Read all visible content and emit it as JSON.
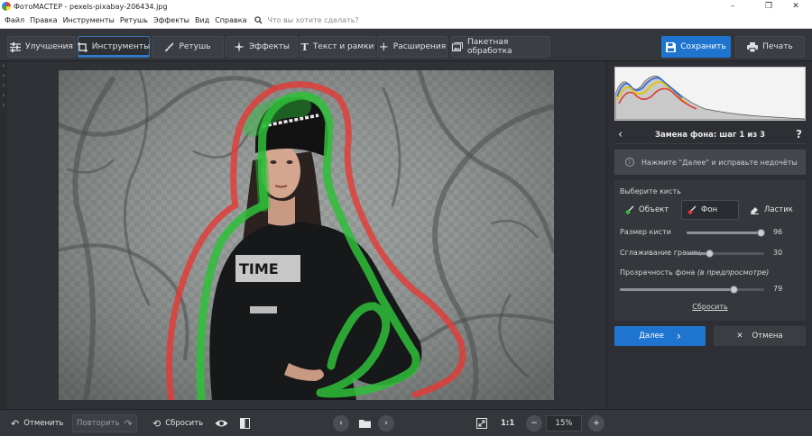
{
  "window": {
    "title": "ФотоМАСТЕР - pexels-pixabay-206434.jpg",
    "minimize_icon": "minimize-icon",
    "maximize_icon": "restore-icon",
    "close_icon": "close-icon"
  },
  "menu": {
    "items": [
      "Файл",
      "Правка",
      "Инструменты",
      "Ретушь",
      "Эффекты",
      "Вид",
      "Справка"
    ],
    "search_placeholder": "Что вы хотите сделать?"
  },
  "toolbar": {
    "tabs": [
      {
        "label": "Улучшения",
        "icon": "sliders-icon"
      },
      {
        "label": "Инструменты",
        "icon": "crop-icon",
        "active": true
      },
      {
        "label": "Ретушь",
        "icon": "brush-icon"
      },
      {
        "label": "Эффекты",
        "icon": "sparkle-icon"
      },
      {
        "label": "Текст и рамки",
        "icon": "text-icon"
      },
      {
        "label": "Расширения",
        "icon": "plus-icon"
      }
    ],
    "batch_label": "Пакетная обработка",
    "save_label": "Сохранить",
    "print_label": "Печать"
  },
  "panel": {
    "step_title": "Замена фона: шаг 1 из 3",
    "hint": "Нажмите \"Далее\" и исправьте недочёты",
    "brush_section_label": "Выберите кисть",
    "brushes": [
      {
        "label": "Объект",
        "color": "#2fbf3a"
      },
      {
        "label": "Фон",
        "color": "#e53935",
        "selected": true
      },
      {
        "label": "Ластик",
        "color": "#e0e0e0"
      }
    ],
    "brush_size": {
      "label": "Размер кисти",
      "value": "96",
      "level": 0.96
    },
    "smoothing": {
      "label": "Сглаживание границ",
      "value": "30",
      "level": 0.3
    },
    "bg_opacity": {
      "label": "Прозрачность фона",
      "note": "(в предпросмотре)",
      "value": "79",
      "level": 0.79
    },
    "reset_label": "Сбросить",
    "next_label": "Далее",
    "cancel_label": "Отмена"
  },
  "bottom": {
    "undo_label": "Отменить",
    "redo_label": "Повторить",
    "reset_label": "Сбросить",
    "zoom_1to1": "1:1",
    "zoom_value": "15%"
  },
  "colors": {
    "accent": "#1f74cf",
    "object_stroke": "#2fbf3a",
    "background_stroke": "#e53935"
  }
}
